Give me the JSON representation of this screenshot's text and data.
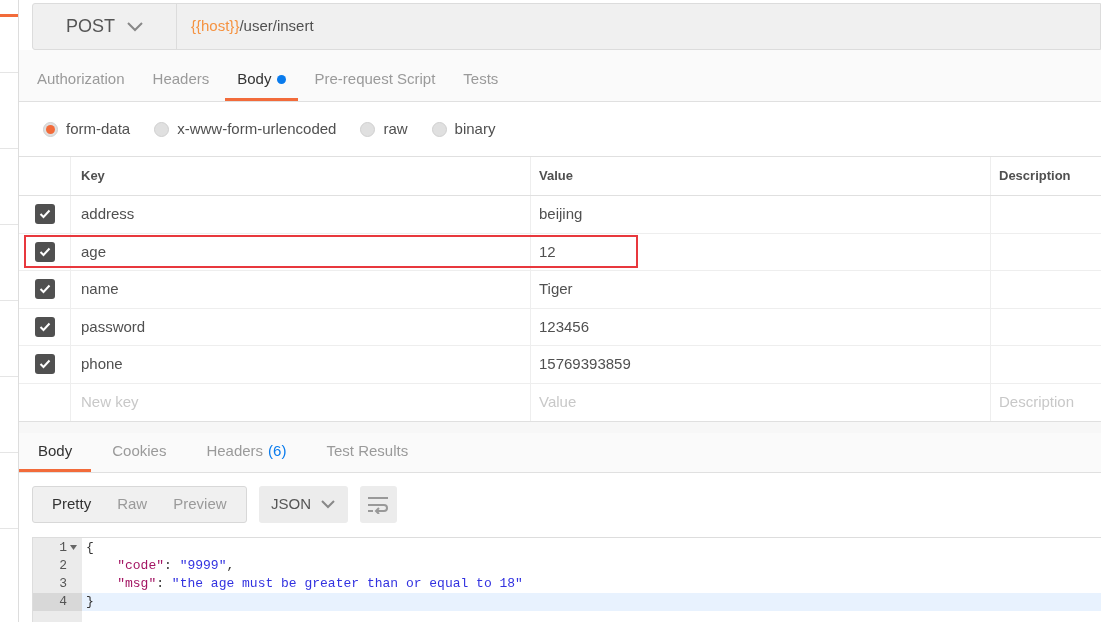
{
  "request": {
    "method": "POST",
    "url_variable": "{{host}}",
    "url_path": "/user/insert"
  },
  "request_tabs": [
    {
      "label": "Authorization",
      "selected": false,
      "dot": false
    },
    {
      "label": "Headers",
      "selected": false,
      "dot": false
    },
    {
      "label": "Body",
      "selected": true,
      "dot": true
    },
    {
      "label": "Pre-request Script",
      "selected": false,
      "dot": false
    },
    {
      "label": "Tests",
      "selected": false,
      "dot": false
    }
  ],
  "body_types": [
    {
      "label": "form-data",
      "selected": true
    },
    {
      "label": "x-www-form-urlencoded",
      "selected": false
    },
    {
      "label": "raw",
      "selected": false
    },
    {
      "label": "binary",
      "selected": false
    }
  ],
  "params_table": {
    "columns": [
      "Key",
      "Value",
      "Description"
    ],
    "rows": [
      {
        "checked": true,
        "key": "address",
        "value": "beijing",
        "highlighted": false
      },
      {
        "checked": true,
        "key": "age",
        "value": "12",
        "highlighted": true
      },
      {
        "checked": true,
        "key": "name",
        "value": "Tiger",
        "highlighted": false
      },
      {
        "checked": true,
        "key": "password",
        "value": "123456",
        "highlighted": false
      },
      {
        "checked": true,
        "key": "phone",
        "value": "15769393859",
        "highlighted": false
      }
    ],
    "new_row": {
      "key_placeholder": "New key",
      "value_placeholder": "Value",
      "description_placeholder": "Description"
    }
  },
  "response_tabs": [
    {
      "label": "Body",
      "selected": true
    },
    {
      "label": "Cookies",
      "selected": false
    },
    {
      "label": "Headers",
      "count": "(6)",
      "selected": false
    },
    {
      "label": "Test Results",
      "selected": false
    }
  ],
  "view_modes": [
    {
      "label": "Pretty",
      "selected": true
    },
    {
      "label": "Raw",
      "selected": false
    },
    {
      "label": "Preview",
      "selected": false
    }
  ],
  "format": "JSON",
  "code_lines": [
    {
      "number": "1",
      "foldable": true,
      "current": false,
      "tokens": [
        {
          "kind": "punct",
          "text": "{"
        }
      ]
    },
    {
      "number": "2",
      "foldable": false,
      "current": false,
      "tokens": [
        {
          "kind": "key",
          "text": "\"code\""
        },
        {
          "kind": "punct",
          "text": ": "
        },
        {
          "kind": "string",
          "text": "\"9999\""
        },
        {
          "kind": "punct",
          "text": ","
        }
      ]
    },
    {
      "number": "3",
      "foldable": false,
      "current": false,
      "tokens": [
        {
          "kind": "key",
          "text": "\"msg\""
        },
        {
          "kind": "punct",
          "text": ": "
        },
        {
          "kind": "string",
          "text": "\"the age must be greater than or equal to 18\""
        }
      ]
    },
    {
      "number": "4",
      "foldable": false,
      "current": true,
      "tokens": [
        {
          "kind": "punct",
          "text": "}"
        }
      ]
    }
  ]
}
